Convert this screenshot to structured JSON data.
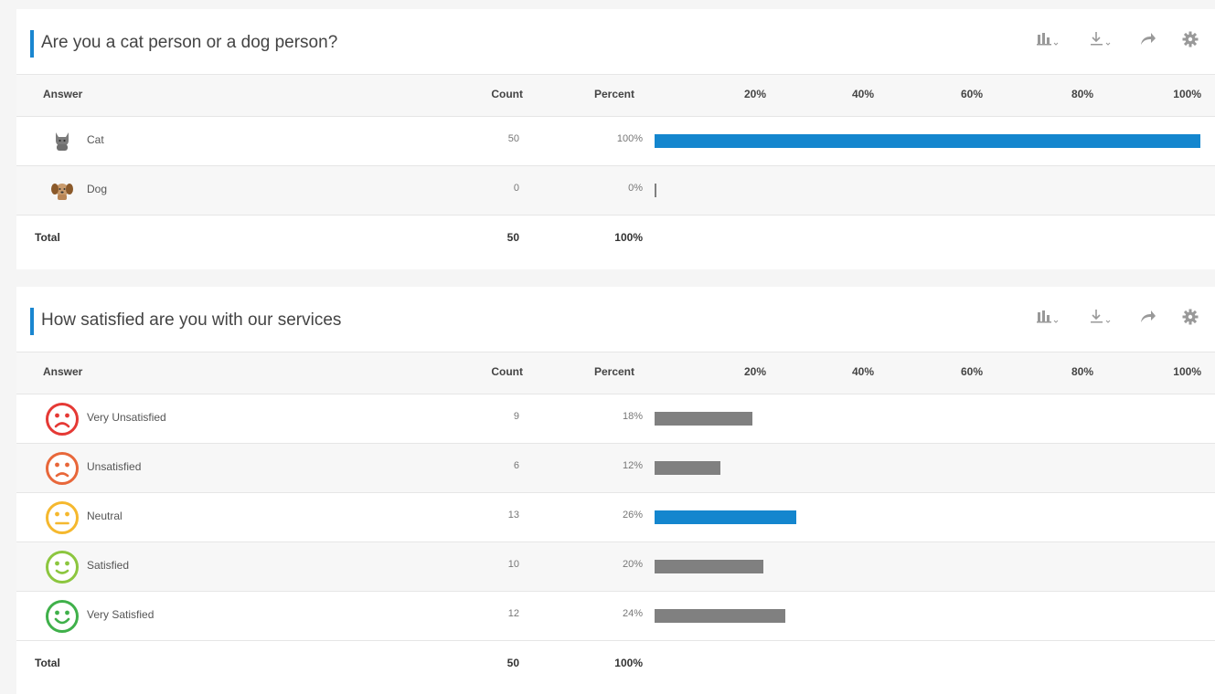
{
  "header_labels": {
    "answer": "Answer",
    "count": "Count",
    "percent": "Percent"
  },
  "ticks": [
    "20%",
    "40%",
    "60%",
    "80%",
    "100%"
  ],
  "total_label": "Total",
  "toolbar_icons": [
    "bar-chart-icon",
    "download-icon",
    "share-icon",
    "settings-icon"
  ],
  "colors": {
    "accent": "#1a86d0",
    "bar_top": "#1486ce",
    "bar_default": "#808080"
  },
  "questions": [
    {
      "title": "Are you a cat person or a dog person?",
      "total": {
        "count": "50",
        "percent": "100%"
      },
      "answers": [
        {
          "label": "Cat",
          "icon": "cat-icon",
          "count": "50",
          "percent": "100%",
          "value": 100,
          "top": true
        },
        {
          "label": "Dog",
          "icon": "dog-icon",
          "count": "0",
          "percent": "0%",
          "value": 0,
          "top": false
        }
      ]
    },
    {
      "title": "How satisfied are you with our services",
      "total": {
        "count": "50",
        "percent": "100%"
      },
      "answers": [
        {
          "label": "Very Unsatisfied",
          "icon": "very-sad-face-icon",
          "count": "9",
          "percent": "18%",
          "value": 18,
          "top": false
        },
        {
          "label": "Unsatisfied",
          "icon": "sad-face-icon",
          "count": "6",
          "percent": "12%",
          "value": 12,
          "top": false
        },
        {
          "label": "Neutral",
          "icon": "neutral-face-icon",
          "count": "13",
          "percent": "26%",
          "value": 26,
          "top": true
        },
        {
          "label": "Satisfied",
          "icon": "happy-face-icon",
          "count": "10",
          "percent": "20%",
          "value": 20,
          "top": false
        },
        {
          "label": "Very Satisfied",
          "icon": "very-happy-face-icon",
          "count": "12",
          "percent": "24%",
          "value": 24,
          "top": false
        }
      ]
    }
  ]
}
